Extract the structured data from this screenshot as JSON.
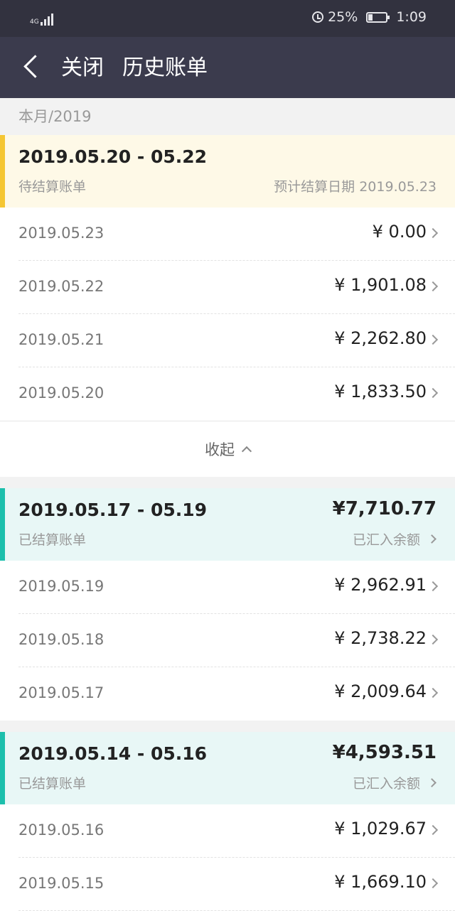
{
  "status_bar": {
    "network": "4G",
    "battery": "25%",
    "time": "1:09"
  },
  "header": {
    "close_label": "关闭",
    "title": "历史账单"
  },
  "month_header": "本月/2019",
  "pending_group": {
    "range": "2019.05.20 - 05.22",
    "status": "待结算账单",
    "estimate": "预计结算日期 2019.05.23",
    "rows": [
      {
        "date": "2019.05.23",
        "amount": "¥ 0.00"
      },
      {
        "date": "2019.05.22",
        "amount": "¥ 1,901.08"
      },
      {
        "date": "2019.05.21",
        "amount": "¥ 2,262.80"
      },
      {
        "date": "2019.05.20",
        "amount": "¥ 1,833.50"
      }
    ],
    "collapse_label": "收起"
  },
  "settled_groups": [
    {
      "range": "2019.05.17 - 05.19",
      "status": "已结算账单",
      "total": "¥7,710.77",
      "deposit": "已汇入余额",
      "rows": [
        {
          "date": "2019.05.19",
          "amount": "¥ 2,962.91"
        },
        {
          "date": "2019.05.18",
          "amount": "¥ 2,738.22"
        },
        {
          "date": "2019.05.17",
          "amount": "¥ 2,009.64"
        }
      ]
    },
    {
      "range": "2019.05.14 - 05.16",
      "status": "已结算账单",
      "total": "¥4,593.51",
      "deposit": "已汇入余额",
      "rows": [
        {
          "date": "2019.05.16",
          "amount": "¥ 1,029.67"
        },
        {
          "date": "2019.05.15",
          "amount": "¥ 1,669.10"
        }
      ]
    }
  ]
}
